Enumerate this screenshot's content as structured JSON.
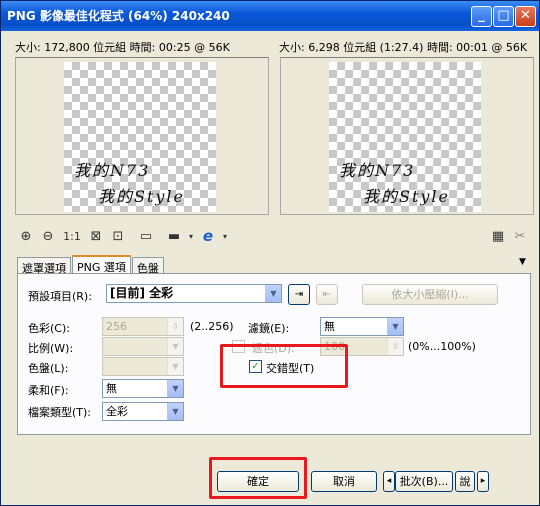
{
  "window": {
    "title": "PNG 影像最佳化程式 (64%) 240x240",
    "minimize": "_",
    "maximize": "□",
    "close": "✕"
  },
  "info": {
    "left": "大小: 172,800 位元組 時間: 00:25 @ 56K",
    "right": "大小: 6,298 位元組 (1:27.4) 時間: 00:01 @ 56K"
  },
  "preview": {
    "line1": "我的N73",
    "line2": "我的Style"
  },
  "toolbar": {
    "zoom_in": "⊕",
    "zoom_out": "⊖",
    "actual_size": "1:1",
    "fit": "⊠",
    "center": "⊡",
    "single_view": "▭",
    "export": "▬",
    "browser": "e"
  },
  "tabs": [
    "遮罩選項",
    "PNG 選項",
    "色盤"
  ],
  "form": {
    "preset_label": "預設項目(R):",
    "preset_value": "[目前] 全彩",
    "size_button": "依大小壓縮(I)...",
    "color_label": "色彩(C):",
    "color_value": "256",
    "color_range": "(2..256)",
    "filter_label": "濾鏡(E):",
    "filter_value": "無",
    "ratio_label": "比例(W):",
    "palette_label": "色盤(L):",
    "dither_label": "遞色(D):",
    "dither_value": "100",
    "dither_range": "(0%...100%)",
    "interlace_label": "交錯型(T)",
    "interlace_checked": "✓",
    "smooth_label": "柔和(F):",
    "smooth_value": "無",
    "filetype_label": "檔案類型(T):",
    "filetype_value": "全彩"
  },
  "buttons": {
    "ok": "確定",
    "cancel": "取消",
    "batch": "批次(B)...",
    "prev": "◂",
    "next": "▸",
    "extra": "說"
  }
}
